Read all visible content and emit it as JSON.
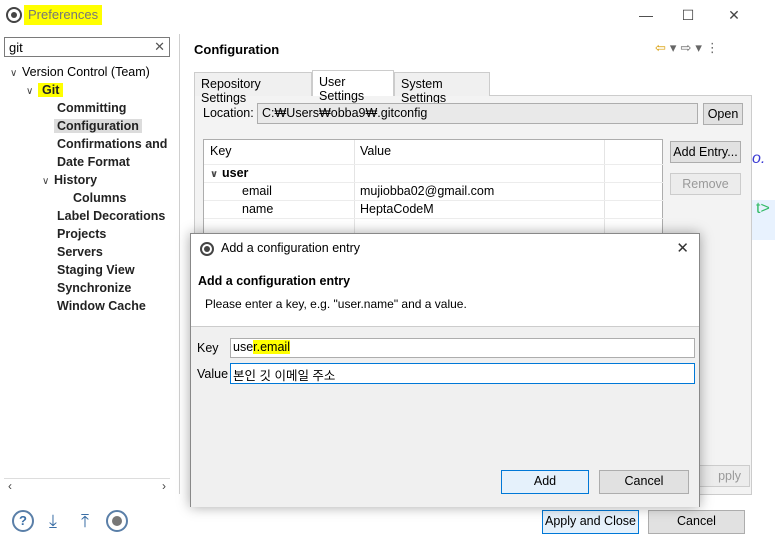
{
  "window": {
    "title": "Preferences",
    "min_icon": "minimize-icon",
    "max_icon": "maximize-icon",
    "close_icon": "close-icon"
  },
  "left": {
    "filter_value": "git",
    "tree": {
      "version_control": "Version Control (Team)",
      "git": "Git",
      "committing": "Committing",
      "configuration": "Configuration",
      "confirmations": "Confirmations and V",
      "date_format": "Date Format",
      "history": "History",
      "columns": "Columns",
      "label_decorations": "Label Decorations",
      "projects": "Projects",
      "servers": "Servers",
      "staging_view": "Staging View",
      "synchronize": "Synchronize",
      "window_cache": "Window Cache"
    }
  },
  "right": {
    "title": "Configuration",
    "tabs": [
      "Repository Settings",
      "User Settings",
      "System Settings"
    ],
    "active_tab": "User Settings",
    "location_label": "Location:",
    "location_value": "C:₩Users₩obba9₩.gitconfig",
    "open_label": "Open",
    "table": {
      "headers": [
        "Key",
        "Value"
      ],
      "section": "user",
      "rows": [
        {
          "key": "email",
          "value": "mujiobba02@gmail.com"
        },
        {
          "key": "name",
          "value": "HeptaCodeM"
        }
      ]
    },
    "add_entry_label": "Add Entry...",
    "remove_label": "Remove",
    "apply_label": "pply"
  },
  "dialog": {
    "title": "Add a configuration entry",
    "heading": "Add a configuration entry",
    "description": "Please enter a key, e.g. \"user.name\" and a value.",
    "key_label": "Key",
    "key_value_pre": "use",
    "key_value_hl": "r.email",
    "value_label": "Value",
    "value_value": "본인 깃 이메일 주소",
    "add_label": "Add",
    "cancel_label": "Cancel"
  },
  "footer": {
    "apply_close_label": "Apply and Close",
    "cancel_label": "Cancel"
  },
  "editor_peek": {
    "line1": "o.",
    "line2": "t>"
  }
}
